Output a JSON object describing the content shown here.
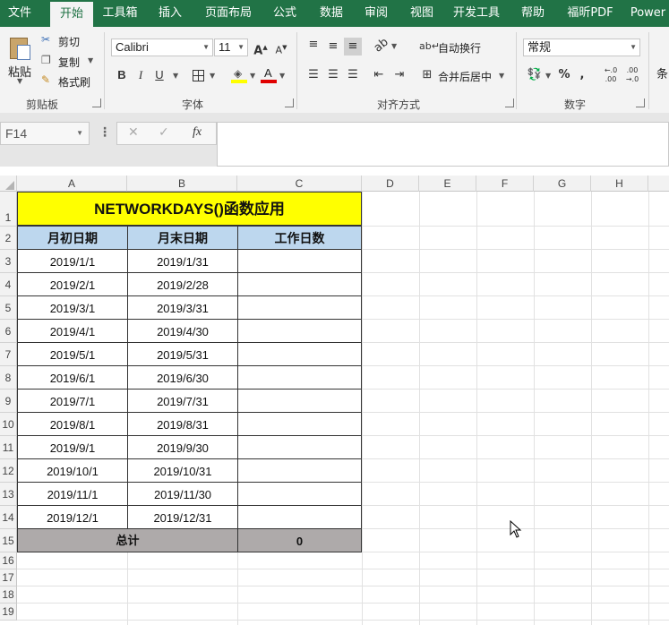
{
  "tabs": [
    "文件",
    "开始",
    "工具箱",
    "插入",
    "页面布局",
    "公式",
    "数据",
    "审阅",
    "视图",
    "开发工具",
    "帮助",
    "福昕PDF",
    "Power"
  ],
  "active_tab": "开始",
  "ribbon": {
    "clipboard": {
      "paste": "粘贴",
      "cut": "剪切",
      "copy": "复制",
      "format_painter": "格式刷",
      "label": "剪贴板"
    },
    "font": {
      "name": "Calibri",
      "size": "11",
      "bold": "B",
      "italic": "I",
      "underline": "U",
      "label": "字体"
    },
    "alignment": {
      "wrap": "自动换行",
      "merge": "合并后居中",
      "label": "对齐方式"
    },
    "number": {
      "format": "常规",
      "label": "数字"
    },
    "cut_off_group": "条"
  },
  "name_box": "F14",
  "formula_icons": {
    "cancel": "✕",
    "enter": "✓",
    "fx": "fx"
  },
  "columns": [
    "A",
    "B",
    "C",
    "D",
    "E",
    "F",
    "G",
    "H"
  ],
  "rows": [
    "1",
    "2",
    "3",
    "4",
    "5",
    "6",
    "7",
    "8",
    "9",
    "10",
    "11",
    "12",
    "13",
    "14",
    "15",
    "16",
    "17",
    "18",
    "19"
  ],
  "sheet": {
    "title": "NETWORKDAYS()函数应用",
    "headers": [
      "月初日期",
      "月末日期",
      "工作日数"
    ],
    "data": [
      [
        "2019/1/1",
        "2019/1/31",
        ""
      ],
      [
        "2019/2/1",
        "2019/2/28",
        ""
      ],
      [
        "2019/3/1",
        "2019/3/31",
        ""
      ],
      [
        "2019/4/1",
        "2019/4/30",
        ""
      ],
      [
        "2019/5/1",
        "2019/5/31",
        ""
      ],
      [
        "2019/6/1",
        "2019/6/30",
        ""
      ],
      [
        "2019/7/1",
        "2019/7/31",
        ""
      ],
      [
        "2019/8/1",
        "2019/8/31",
        ""
      ],
      [
        "2019/9/1",
        "2019/9/30",
        ""
      ],
      [
        "2019/10/1",
        "2019/10/31",
        ""
      ],
      [
        "2019/11/1",
        "2019/11/30",
        ""
      ],
      [
        "2019/12/1",
        "2019/12/31",
        ""
      ]
    ],
    "total_label": "总计",
    "total_value": "0"
  },
  "colors": {
    "ribbon_green": "#217346",
    "title_fill": "#FFFF00",
    "header_fill": "#BDD7EE",
    "total_fill": "#AEAAAA"
  }
}
